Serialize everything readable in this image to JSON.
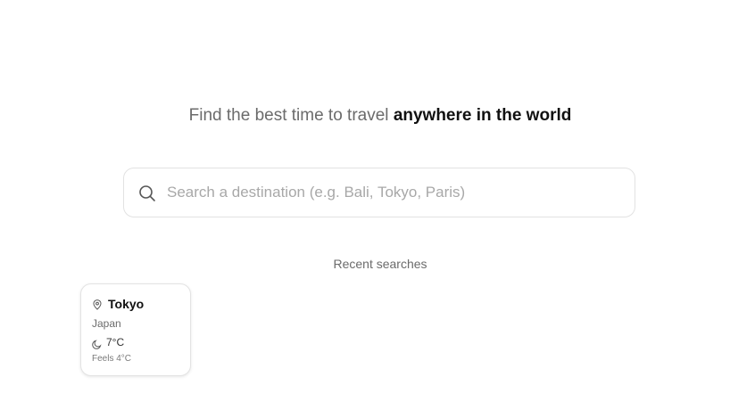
{
  "hero": {
    "headline_prefix": "Find the best time to travel ",
    "headline_emphasis": "anywhere in the world"
  },
  "search": {
    "placeholder": "Search a destination (e.g. Bali, Tokyo, Paris)",
    "value": "",
    "icon": "search-icon"
  },
  "recent": {
    "label": "Recent searches",
    "items": [
      {
        "city": "Tokyo",
        "country": "Japan",
        "temperature": "7°C",
        "feels_like": "Feels 4°C",
        "location_icon": "map-pin-icon",
        "weather_icon": "moon-icon"
      }
    ]
  }
}
